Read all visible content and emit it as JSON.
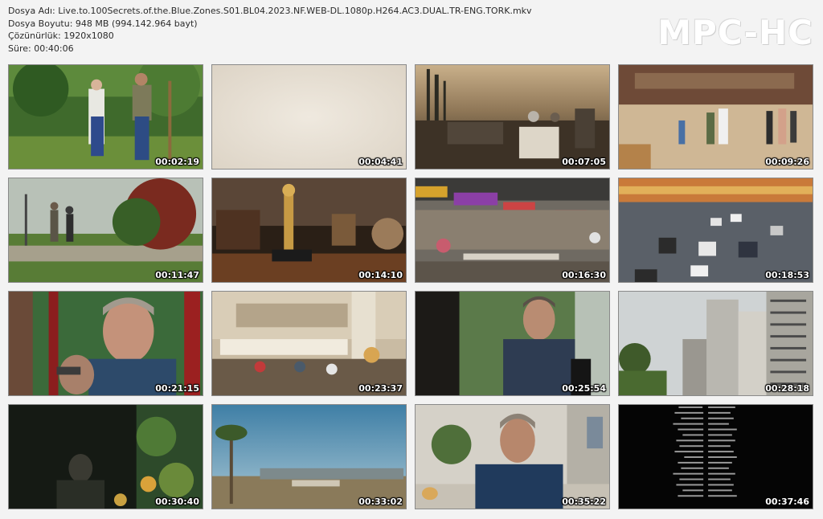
{
  "file_info": {
    "name_line": "Dosya Adı: Live.to.100Secrets.of.the.Blue.Zones.S01.BL04.2023.NF.WEB-DL.1080p.H264.AC3.DUAL.TR-ENG.TORK.mkv",
    "size_line": "Dosya Boyutu: 948 MB (994.142.964 bayt)",
    "resolution_line": "Çözünürlük: 1920x1080",
    "duration_line": "Süre: 00:40:06"
  },
  "logo": {
    "text": "MPC-HC"
  },
  "thumbnails": [
    {
      "time": "00:02:19",
      "scene": "garden-elderly-men"
    },
    {
      "time": "00:04:41",
      "scene": "blank-cream-frame"
    },
    {
      "time": "00:07:05",
      "scene": "outdoor-dinner-sunset"
    },
    {
      "time": "00:09:26",
      "scene": "people-walking-plaza"
    },
    {
      "time": "00:11:47",
      "scene": "park-walkers"
    },
    {
      "time": "00:14:10",
      "scene": "trophy-shelf"
    },
    {
      "time": "00:16:30",
      "scene": "hawker-center"
    },
    {
      "time": "00:18:53",
      "scene": "highway-traffic"
    },
    {
      "time": "00:21:15",
      "scene": "man-closeup-outdoors"
    },
    {
      "time": "00:23:37",
      "scene": "food-court-interior"
    },
    {
      "time": "00:25:54",
      "scene": "man-seated-interview"
    },
    {
      "time": "00:28:18",
      "scene": "apartment-towers"
    },
    {
      "time": "00:30:40",
      "scene": "dark-night-lights"
    },
    {
      "time": "00:33:02",
      "scene": "palm-tree-landscape"
    },
    {
      "time": "00:35:22",
      "scene": "man-talking-indoors"
    },
    {
      "time": "00:37:46",
      "scene": "end-credits"
    }
  ]
}
